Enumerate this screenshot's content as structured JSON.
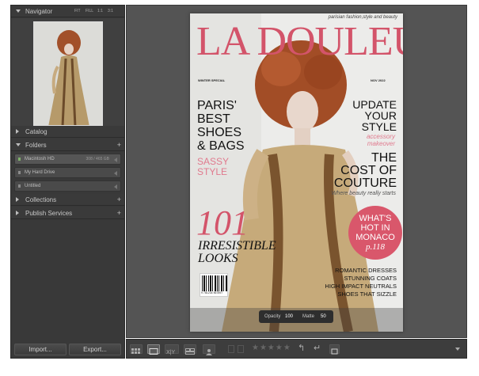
{
  "navigator": {
    "title": "Navigator",
    "zoom": [
      "FIT",
      "FILL",
      "1:1",
      "3:1"
    ]
  },
  "panels": {
    "catalog": "Catalog",
    "folders": "Folders",
    "collections": "Collections",
    "publish": "Publish Services"
  },
  "volumes": [
    {
      "name": "Macintosh HD",
      "size": "308 / 465 GB"
    },
    {
      "name": "My Hard Drive",
      "size": ""
    },
    {
      "name": "Untitled",
      "size": ""
    }
  ],
  "buttons": {
    "import": "Import...",
    "export": "Export..."
  },
  "overlay": {
    "opacity_label": "Opacity",
    "opacity_value": "100",
    "matte_label": "Matte",
    "matte_value": "50"
  },
  "cover": {
    "tagline": "parisian fashion,style and beauty",
    "masthead": "LA DOULEUR",
    "issue_left": "WINTER SPECIAL",
    "issue_right": "NOV 2022",
    "h1_l1": "PARIS'",
    "h1_l2": "BEST",
    "h1_l3": "SHOES",
    "h1_l4": "& BAGS",
    "sassy_l1": "SASSY",
    "sassy_l2": "STYLE",
    "update_l1": "UPDATE",
    "update_l2": "YOUR",
    "update_l3": "STYLE",
    "accessory_l1": "accessory",
    "accessory_l2": "makeover",
    "cost_l1": "THE",
    "cost_l2": "COST OF",
    "cost_l3": "COUTURE",
    "beauty": "Where beauty really starts",
    "num": "101",
    "irr": "IRRESISTIBLE",
    "looks": "LOOKS",
    "whats_l1": "WHAT'S",
    "whats_l2": "HOT IN",
    "whats_l3": "MONACO",
    "whats_l4": "p.118",
    "list_l1": "ROMANTIC DRESSES",
    "list_l2": "STUNNING COATS",
    "list_l3": "HIGH IMPACT NEUTRALS",
    "list_l4": "SHOES THAT SIZZLE",
    "barcode_num": "9 781234 567897"
  },
  "colors": {
    "masthead": "#d3546a",
    "sassy": "#e07a8e",
    "circle": "#d9576b",
    "panel": "#393939",
    "main": "#545454"
  }
}
